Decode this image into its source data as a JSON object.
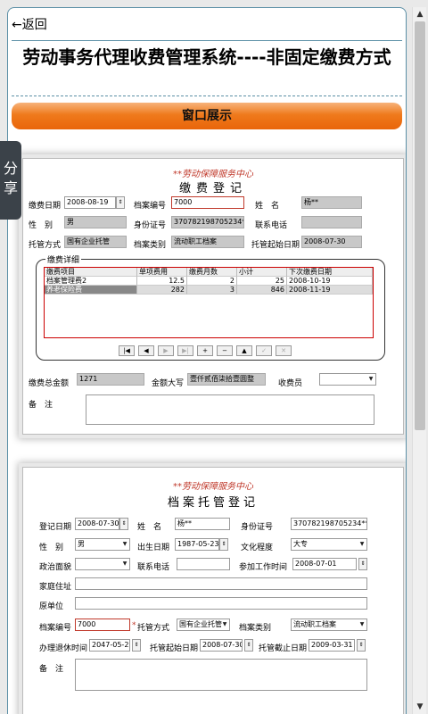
{
  "header": {
    "back_label": "←返回",
    "title": "劳动事务代理收费管理系统----非固定缴费方式",
    "show_button": "窗口展示"
  },
  "share": {
    "label": "分享"
  },
  "scrollbar": {
    "up": "▲",
    "down": "▼"
  },
  "colors": {
    "accent_orange": "#ef7a1c",
    "border": "#5b8fa6",
    "share_bg": "#3b4249",
    "org_red": "#c0392b"
  },
  "form1": {
    "org": "**劳动保障服务中心",
    "title": "缴费登记",
    "pay_date_label": "缴费日期",
    "pay_date": "2008-08-19",
    "archive_no_label": "档案编号",
    "archive_no": "7000",
    "name_label": "姓　名",
    "name": "杨**",
    "gender_label": "性　别",
    "gender": "男",
    "id_label": "身份证号",
    "id_no": "370782198705234****",
    "phone_label": "联系电话",
    "phone": "",
    "trust_label": "托管方式",
    "trust": "国有企业托管",
    "archive_type_label": "档案类别",
    "archive_type": "流动职工档案",
    "trust_start_label": "托管起始日期",
    "trust_start": "2008-07-30",
    "detail_legend": "缴费详细",
    "grid_headers": [
      "缴费项目",
      "单项费用",
      "缴费月数",
      "小计",
      "下次缴费日期"
    ],
    "grid_rows": [
      [
        "档案管理费2",
        "12.5",
        "2",
        "25",
        "2008-10-19"
      ],
      [
        "养老保险费",
        "282",
        "3",
        "846",
        "2008-11-19"
      ]
    ],
    "nav_buttons": [
      "|◀",
      "◀",
      "▶",
      "▶|",
      "+",
      "−",
      "▲",
      "✓",
      "✕"
    ],
    "total_label": "缴费总金额",
    "total": "1271",
    "upper_label": "金额大写",
    "upper": "壹仟贰佰柒拾壹圆整",
    "collector_label": "收费员",
    "collector": "",
    "note_label": "备　注",
    "note": ""
  },
  "form2": {
    "org": "**劳动保障服务中心",
    "title": "档案托管登记",
    "reg_date_label": "登记日期",
    "reg_date": "2008-07-30",
    "name_label": "姓　名",
    "name": "杨**",
    "id_label": "身份证号",
    "id_no": "370782198705234****",
    "gender_label": "性　别",
    "gender": "男",
    "birth_label": "出生日期",
    "birth": "1987-05-23",
    "edu_label": "文化程度",
    "edu": "大专",
    "politics_label": "政治面貌",
    "politics": "",
    "phone_label": "联系电话",
    "phone": "",
    "work_date_label": "参加工作时间",
    "work_date": "2008-07-01",
    "address_label": "家庭住址",
    "address": "",
    "unit_label": "原单位",
    "unit": "",
    "archive_no_label": "档案编号",
    "archive_no": "7000",
    "trust_label": "托管方式",
    "trust": "国有企业托管",
    "archive_type_label": "档案类别",
    "archive_type": "流动职工档案",
    "retire_label": "办理退休时间",
    "retire": "2047-05-23",
    "trust_start_label": "托管起始日期",
    "trust_start": "2008-07-30",
    "trust_end_label": "托管截止日期",
    "trust_end": "2009-03-31",
    "note_label": "备　注",
    "note": ""
  }
}
